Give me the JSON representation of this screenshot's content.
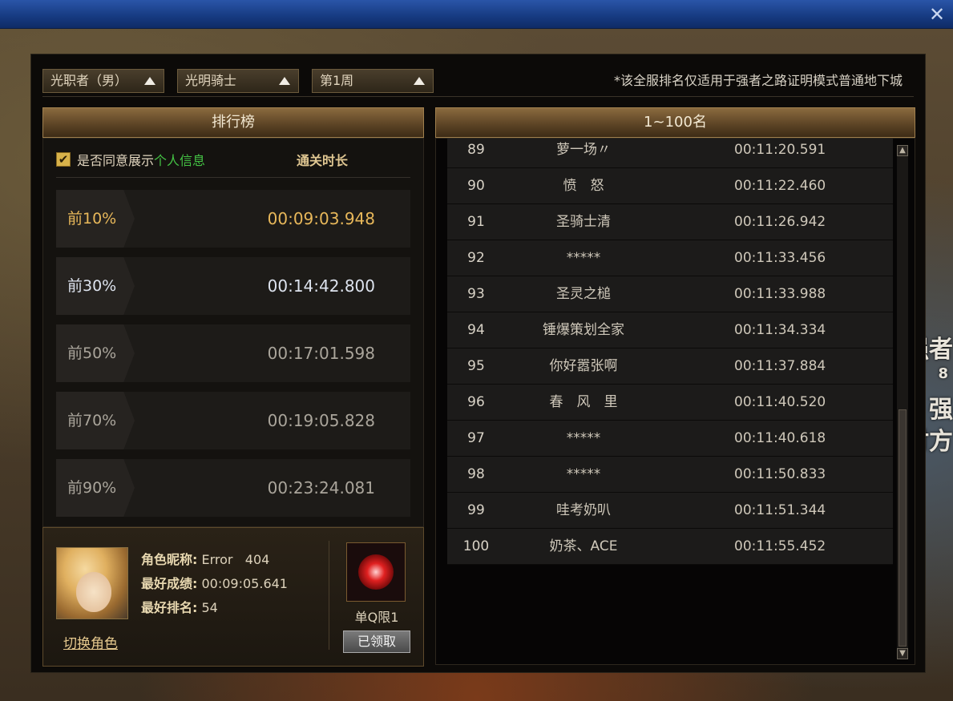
{
  "header": {
    "close_glyph": "✕"
  },
  "background_text": {
    "line1": "强者",
    "line2": "8",
    "line3": "强",
    "line4": "时方"
  },
  "filters": [
    {
      "label": "光职者（男）"
    },
    {
      "label": "光明骑士"
    },
    {
      "label": "第1周"
    }
  ],
  "notice": "*该全服排名仅适用于强者之路证明模式普通地下城",
  "left_panel": {
    "title": "排行榜",
    "agree_prefix": "是否同意展示",
    "agree_highlight": "个人信息",
    "agree_checked": true,
    "time_header": "通关时长",
    "percentiles": [
      {
        "label": "前10%",
        "time": "00:09:03.948",
        "style": "gold"
      },
      {
        "label": "前30%",
        "time": "00:14:42.800",
        "style": "silver"
      },
      {
        "label": "前50%",
        "time": "00:17:01.598",
        "style": "grey"
      },
      {
        "label": "前70%",
        "time": "00:19:05.828",
        "style": "grey"
      },
      {
        "label": "前90%",
        "time": "00:23:24.081",
        "style": "grey"
      }
    ]
  },
  "player": {
    "name_label": "角色昵称:",
    "name_value": "Error   404",
    "best_time_label": "最好成绩:",
    "best_time_value": "00:09:05.641",
    "best_rank_label": "最好排名:",
    "best_rank_value": "54",
    "switch_role": "切换角色",
    "reward_label": "单Q限1",
    "claimed_button": "已领取"
  },
  "right_panel": {
    "title": "1~100名",
    "rows": [
      {
        "rank": "89",
        "name": "萝一场〃",
        "time": "00:11:20.591"
      },
      {
        "rank": "90",
        "name": "愤　怒",
        "time": "00:11:22.460"
      },
      {
        "rank": "91",
        "name": "圣骑士清",
        "time": "00:11:26.942"
      },
      {
        "rank": "92",
        "name": "*****",
        "time": "00:11:33.456"
      },
      {
        "rank": "93",
        "name": "圣灵之槌",
        "time": "00:11:33.988"
      },
      {
        "rank": "94",
        "name": "锤爆策划全家",
        "time": "00:11:34.334"
      },
      {
        "rank": "95",
        "name": "你好嚣张啊",
        "time": "00:11:37.884"
      },
      {
        "rank": "96",
        "name": "春　风　里",
        "time": "00:11:40.520"
      },
      {
        "rank": "97",
        "name": "*****",
        "time": "00:11:40.618"
      },
      {
        "rank": "98",
        "name": "*****",
        "time": "00:11:50.833"
      },
      {
        "rank": "99",
        "name": "哇考奶叭",
        "time": "00:11:51.344"
      },
      {
        "rank": "100",
        "name": "奶茶、ACE",
        "time": "00:11:55.452"
      }
    ],
    "scroll_position": 0.95
  },
  "colors": {
    "accent_gold": "#e8b85a",
    "highlight_green": "#44c244",
    "titlebar_blue": "#163a80"
  },
  "icons": [
    "close-icon",
    "chevron-up-icon",
    "checkbox-checked-icon",
    "gem-reward-icon",
    "scroll-up-icon",
    "scroll-down-icon"
  ]
}
